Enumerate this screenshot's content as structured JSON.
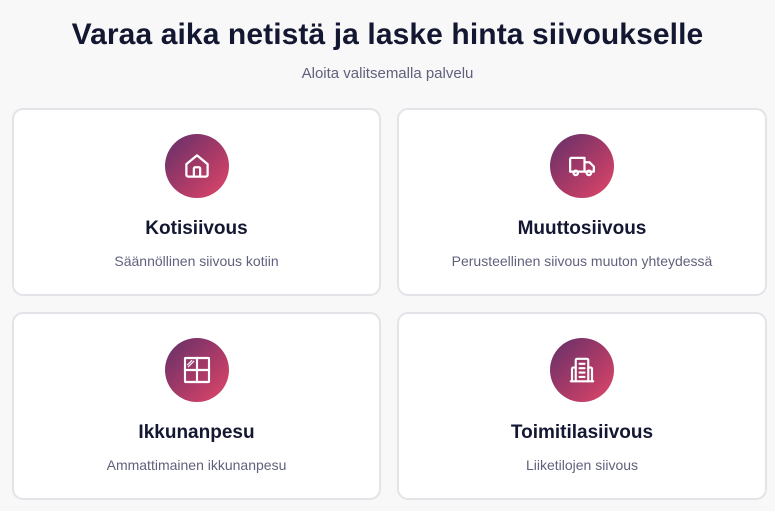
{
  "header": {
    "title": "Varaa aika netistä ja laske hinta siivoukselle",
    "subtitle": "Aloita valitsemalla palvelu"
  },
  "services": [
    {
      "icon": "home-icon",
      "title": "Kotisiivous",
      "description": "Säännöllinen siivous kotiin"
    },
    {
      "icon": "truck-icon",
      "title": "Muuttosiivous",
      "description": "Perusteellinen siivous muuton yhteydessä"
    },
    {
      "icon": "window-icon",
      "title": "Ikkunanpesu",
      "description": "Ammattimainen ikkunanpesu"
    },
    {
      "icon": "office-building-icon",
      "title": "Toimitilasiivous",
      "description": "Liiketilojen siivous"
    }
  ],
  "colors": {
    "icon_gradient_start": "#62306a",
    "icon_gradient_end": "#e1476a",
    "text_primary": "#141732",
    "text_secondary": "#60617c"
  }
}
